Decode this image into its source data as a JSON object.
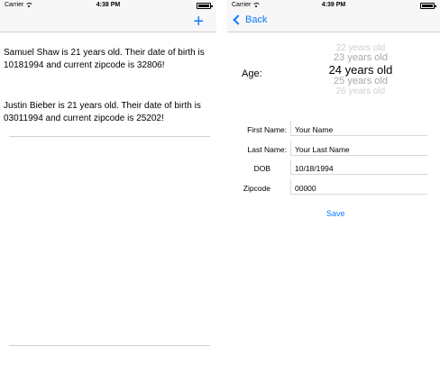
{
  "left": {
    "status": {
      "carrier": "Carrier",
      "time": "4:38 PM"
    },
    "nav": {
      "add_label": "+"
    },
    "records": [
      "Samuel Shaw is 21 years old. Their date of birth is 10181994 and current zipcode is 32806!",
      "Justin Bieber is 21 years old. Their date of birth is 03011994 and current zipcode is 25202!"
    ]
  },
  "right": {
    "status": {
      "carrier": "Carrier",
      "time": "4:39 PM"
    },
    "nav": {
      "back_label": "Back"
    },
    "age": {
      "label": "Age:",
      "picker": [
        "22 years old",
        "23 years old",
        "24 years old",
        "25 years old",
        "26 years old"
      ],
      "selected": "24 years old"
    },
    "form": {
      "first_name": {
        "label": "First Name:",
        "value": "Your Name"
      },
      "last_name": {
        "label": "Last Name:",
        "value": "Your Last Name"
      },
      "dob": {
        "label": "DOB",
        "value": "10/18/1994"
      },
      "zipcode": {
        "label": "Zipcode",
        "value": "00000"
      }
    },
    "save_label": "Save"
  },
  "colors": {
    "accent": "#0a7aff",
    "bar_bg": "#f7f7f7"
  }
}
